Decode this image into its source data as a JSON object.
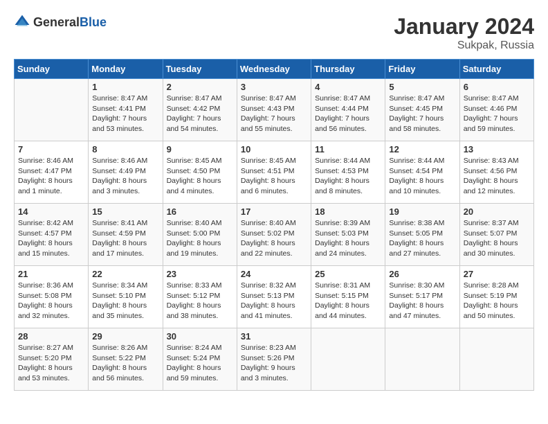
{
  "header": {
    "logo_general": "General",
    "logo_blue": "Blue",
    "month": "January 2024",
    "location": "Sukpak, Russia"
  },
  "days_of_week": [
    "Sunday",
    "Monday",
    "Tuesday",
    "Wednesday",
    "Thursday",
    "Friday",
    "Saturday"
  ],
  "weeks": [
    [
      {
        "day": "",
        "info": ""
      },
      {
        "day": "1",
        "info": "Sunrise: 8:47 AM\nSunset: 4:41 PM\nDaylight: 7 hours\nand 53 minutes."
      },
      {
        "day": "2",
        "info": "Sunrise: 8:47 AM\nSunset: 4:42 PM\nDaylight: 7 hours\nand 54 minutes."
      },
      {
        "day": "3",
        "info": "Sunrise: 8:47 AM\nSunset: 4:43 PM\nDaylight: 7 hours\nand 55 minutes."
      },
      {
        "day": "4",
        "info": "Sunrise: 8:47 AM\nSunset: 4:44 PM\nDaylight: 7 hours\nand 56 minutes."
      },
      {
        "day": "5",
        "info": "Sunrise: 8:47 AM\nSunset: 4:45 PM\nDaylight: 7 hours\nand 58 minutes."
      },
      {
        "day": "6",
        "info": "Sunrise: 8:47 AM\nSunset: 4:46 PM\nDaylight: 7 hours\nand 59 minutes."
      }
    ],
    [
      {
        "day": "7",
        "info": "Sunrise: 8:46 AM\nSunset: 4:47 PM\nDaylight: 8 hours\nand 1 minute."
      },
      {
        "day": "8",
        "info": "Sunrise: 8:46 AM\nSunset: 4:49 PM\nDaylight: 8 hours\nand 3 minutes."
      },
      {
        "day": "9",
        "info": "Sunrise: 8:45 AM\nSunset: 4:50 PM\nDaylight: 8 hours\nand 4 minutes."
      },
      {
        "day": "10",
        "info": "Sunrise: 8:45 AM\nSunset: 4:51 PM\nDaylight: 8 hours\nand 6 minutes."
      },
      {
        "day": "11",
        "info": "Sunrise: 8:44 AM\nSunset: 4:53 PM\nDaylight: 8 hours\nand 8 minutes."
      },
      {
        "day": "12",
        "info": "Sunrise: 8:44 AM\nSunset: 4:54 PM\nDaylight: 8 hours\nand 10 minutes."
      },
      {
        "day": "13",
        "info": "Sunrise: 8:43 AM\nSunset: 4:56 PM\nDaylight: 8 hours\nand 12 minutes."
      }
    ],
    [
      {
        "day": "14",
        "info": "Sunrise: 8:42 AM\nSunset: 4:57 PM\nDaylight: 8 hours\nand 15 minutes."
      },
      {
        "day": "15",
        "info": "Sunrise: 8:41 AM\nSunset: 4:59 PM\nDaylight: 8 hours\nand 17 minutes."
      },
      {
        "day": "16",
        "info": "Sunrise: 8:40 AM\nSunset: 5:00 PM\nDaylight: 8 hours\nand 19 minutes."
      },
      {
        "day": "17",
        "info": "Sunrise: 8:40 AM\nSunset: 5:02 PM\nDaylight: 8 hours\nand 22 minutes."
      },
      {
        "day": "18",
        "info": "Sunrise: 8:39 AM\nSunset: 5:03 PM\nDaylight: 8 hours\nand 24 minutes."
      },
      {
        "day": "19",
        "info": "Sunrise: 8:38 AM\nSunset: 5:05 PM\nDaylight: 8 hours\nand 27 minutes."
      },
      {
        "day": "20",
        "info": "Sunrise: 8:37 AM\nSunset: 5:07 PM\nDaylight: 8 hours\nand 30 minutes."
      }
    ],
    [
      {
        "day": "21",
        "info": "Sunrise: 8:36 AM\nSunset: 5:08 PM\nDaylight: 8 hours\nand 32 minutes."
      },
      {
        "day": "22",
        "info": "Sunrise: 8:34 AM\nSunset: 5:10 PM\nDaylight: 8 hours\nand 35 minutes."
      },
      {
        "day": "23",
        "info": "Sunrise: 8:33 AM\nSunset: 5:12 PM\nDaylight: 8 hours\nand 38 minutes."
      },
      {
        "day": "24",
        "info": "Sunrise: 8:32 AM\nSunset: 5:13 PM\nDaylight: 8 hours\nand 41 minutes."
      },
      {
        "day": "25",
        "info": "Sunrise: 8:31 AM\nSunset: 5:15 PM\nDaylight: 8 hours\nand 44 minutes."
      },
      {
        "day": "26",
        "info": "Sunrise: 8:30 AM\nSunset: 5:17 PM\nDaylight: 8 hours\nand 47 minutes."
      },
      {
        "day": "27",
        "info": "Sunrise: 8:28 AM\nSunset: 5:19 PM\nDaylight: 8 hours\nand 50 minutes."
      }
    ],
    [
      {
        "day": "28",
        "info": "Sunrise: 8:27 AM\nSunset: 5:20 PM\nDaylight: 8 hours\nand 53 minutes."
      },
      {
        "day": "29",
        "info": "Sunrise: 8:26 AM\nSunset: 5:22 PM\nDaylight: 8 hours\nand 56 minutes."
      },
      {
        "day": "30",
        "info": "Sunrise: 8:24 AM\nSunset: 5:24 PM\nDaylight: 8 hours\nand 59 minutes."
      },
      {
        "day": "31",
        "info": "Sunrise: 8:23 AM\nSunset: 5:26 PM\nDaylight: 9 hours\nand 3 minutes."
      },
      {
        "day": "",
        "info": ""
      },
      {
        "day": "",
        "info": ""
      },
      {
        "day": "",
        "info": ""
      }
    ]
  ]
}
